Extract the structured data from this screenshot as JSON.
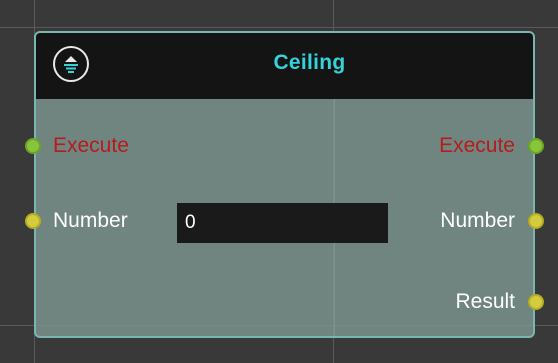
{
  "node": {
    "title": "Ceiling",
    "icon": "ceiling-function-icon",
    "inputs": [
      {
        "label": "Execute",
        "kind": "exec"
      },
      {
        "label": "Number",
        "kind": "data",
        "value": "0"
      }
    ],
    "outputs": [
      {
        "label": "Execute",
        "kind": "exec"
      },
      {
        "label": "Number",
        "kind": "data"
      },
      {
        "label": "Result",
        "kind": "data"
      }
    ]
  },
  "colors": {
    "title": "#33d3d9",
    "exec_label": "#b51c1c",
    "exec_port": "#88c53a",
    "data_port": "#d4cc3e",
    "node_border": "#79b6b1",
    "header_bg": "#141414"
  }
}
